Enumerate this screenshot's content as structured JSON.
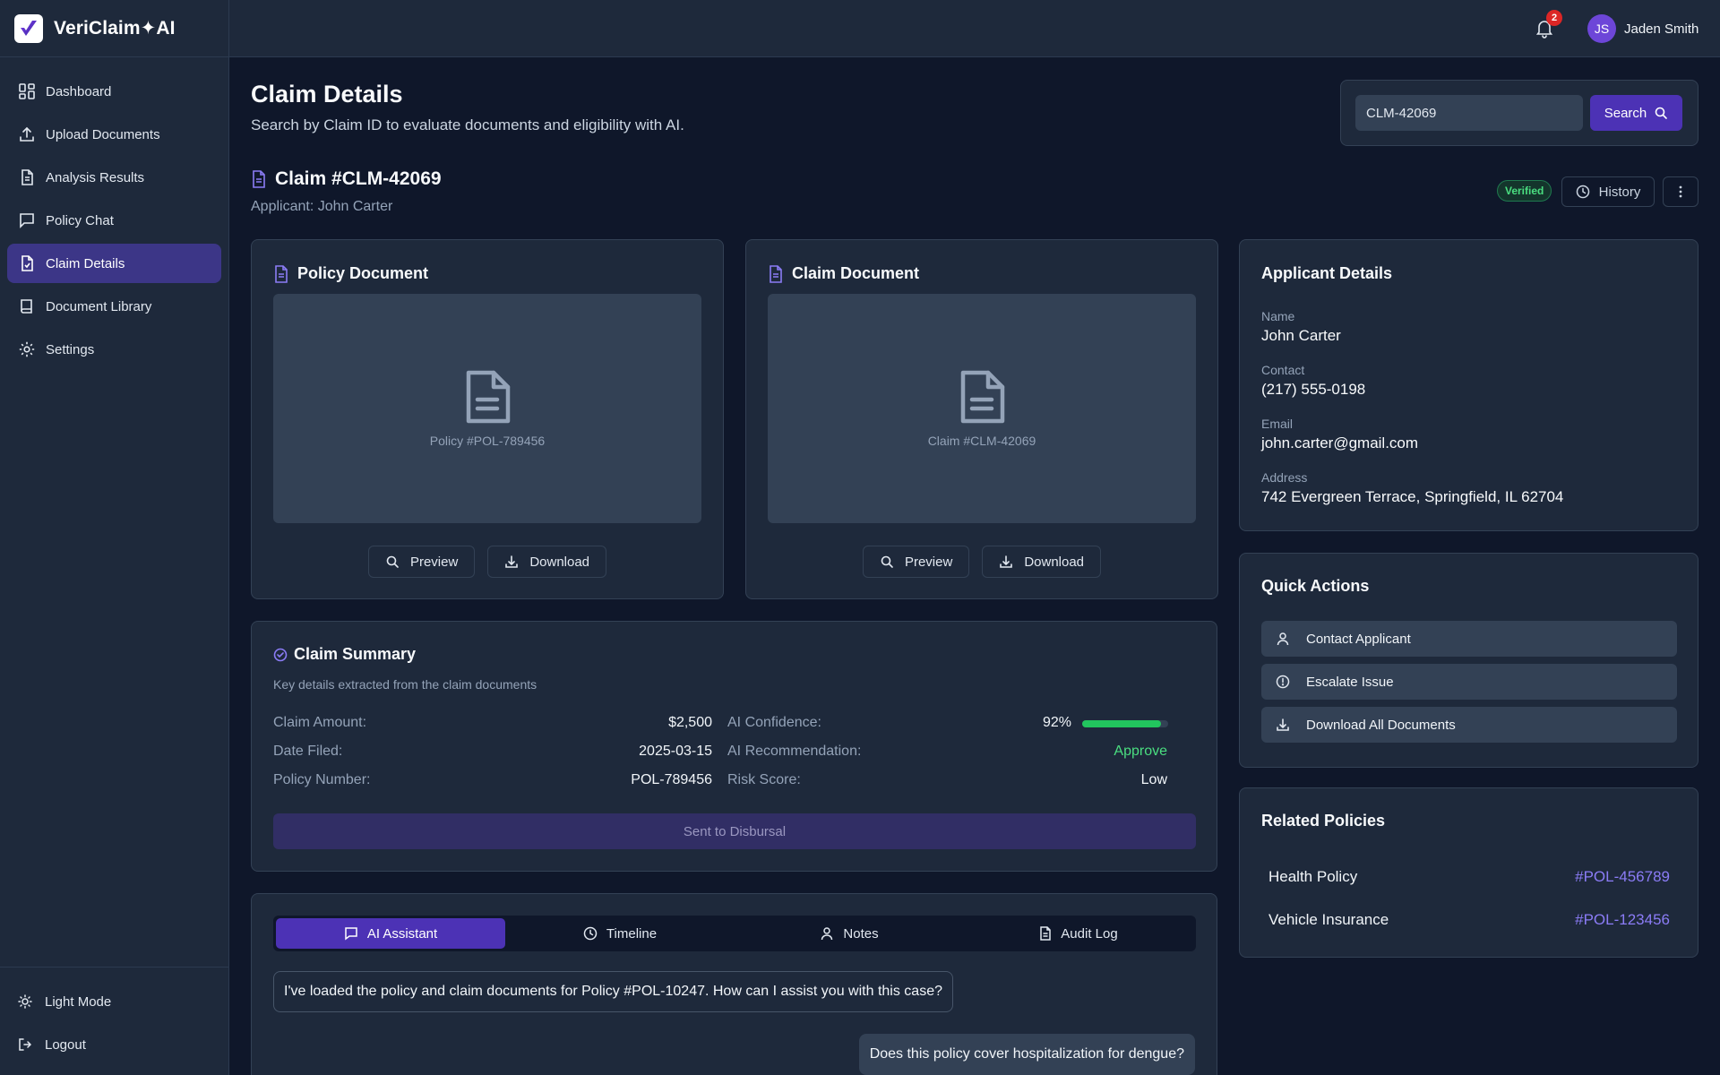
{
  "app": {
    "name": "VeriClaim✦AI"
  },
  "sidebar": {
    "items": [
      {
        "label": "Dashboard",
        "icon": "dashboard-icon"
      },
      {
        "label": "Upload Documents",
        "icon": "upload-icon"
      },
      {
        "label": "Analysis Results",
        "icon": "document-icon"
      },
      {
        "label": "Policy Chat",
        "icon": "chat-icon"
      },
      {
        "label": "Claim Details",
        "icon": "claim-check-icon",
        "active": true
      },
      {
        "label": "Document Library",
        "icon": "book-icon"
      },
      {
        "label": "Settings",
        "icon": "gear-icon"
      }
    ],
    "light_mode_label": "Light Mode",
    "logout_label": "Logout"
  },
  "topbar": {
    "notification_count": "2",
    "user_initials": "JS",
    "user_name": "Jaden Smith"
  },
  "header": {
    "title": "Claim Details",
    "subtitle": "Search by Claim ID to evaluate documents and eligibility with AI."
  },
  "search": {
    "value": "CLM-42069",
    "button_label": "Search"
  },
  "claim": {
    "title": "Claim #CLM-42069",
    "applicant_line": "Applicant: John Carter",
    "status_badge": "Verified",
    "history_label": "History"
  },
  "policy_doc": {
    "title": "Policy Document",
    "caption": "Policy #POL-789456",
    "preview_label": "Preview",
    "download_label": "Download"
  },
  "claim_doc": {
    "title": "Claim Document",
    "caption": "Claim #CLM-42069",
    "preview_label": "Preview",
    "download_label": "Download"
  },
  "summary": {
    "title": "Claim Summary",
    "subtitle": "Key details extracted from the claim documents",
    "claim_amount_label": "Claim Amount:",
    "claim_amount": "$2,500",
    "date_filed_label": "Date Filed:",
    "date_filed": "2025-03-15",
    "policy_number_label": "Policy Number:",
    "policy_number": "POL-789456",
    "ai_confidence_label": "AI Confidence:",
    "ai_confidence": "92%",
    "ai_confidence_fraction": 0.92,
    "ai_recommendation_label": "AI Recommendation:",
    "ai_recommendation": "Approve",
    "risk_score_label": "Risk Score:",
    "risk_score": "Low",
    "disbursal_label": "Sent to Disbursal",
    "colors": {
      "approve": "#4ade80",
      "confidence_bar": "#22c55e"
    }
  },
  "assistant": {
    "tabs": [
      {
        "label": "AI Assistant",
        "icon": "chat-icon",
        "active": true
      },
      {
        "label": "Timeline",
        "icon": "clock-icon"
      },
      {
        "label": "Notes",
        "icon": "user-icon"
      },
      {
        "label": "Audit Log",
        "icon": "document-icon"
      }
    ],
    "messages": [
      {
        "role": "ai",
        "text": "I've loaded the policy and claim documents for Policy #POL-10247. How can I assist you with this case?"
      },
      {
        "role": "user",
        "text": "Does this policy cover hospitalization for dengue?"
      }
    ]
  },
  "applicant": {
    "title": "Applicant Details",
    "name_label": "Name",
    "name": "John Carter",
    "contact_label": "Contact",
    "contact": "(217) 555-0198",
    "email_label": "Email",
    "email": "john.carter@gmail.com",
    "address_label": "Address",
    "address": "742 Evergreen Terrace, Springfield, IL 62704"
  },
  "quick_actions": {
    "title": "Quick Actions",
    "items": [
      {
        "label": "Contact Applicant",
        "icon": "user-icon"
      },
      {
        "label": "Escalate Issue",
        "icon": "alert-icon"
      },
      {
        "label": "Download All Documents",
        "icon": "download-icon"
      }
    ]
  },
  "related_policies": {
    "title": "Related Policies",
    "items": [
      {
        "name": "Health Policy",
        "id": "#POL-456789"
      },
      {
        "name": "Vehicle Insurance",
        "id": "#POL-123456"
      }
    ]
  },
  "theme": {
    "accent": "#4c32b5",
    "link": "#8b7cf6",
    "background": "#0f172a",
    "panel": "#1e293b"
  }
}
